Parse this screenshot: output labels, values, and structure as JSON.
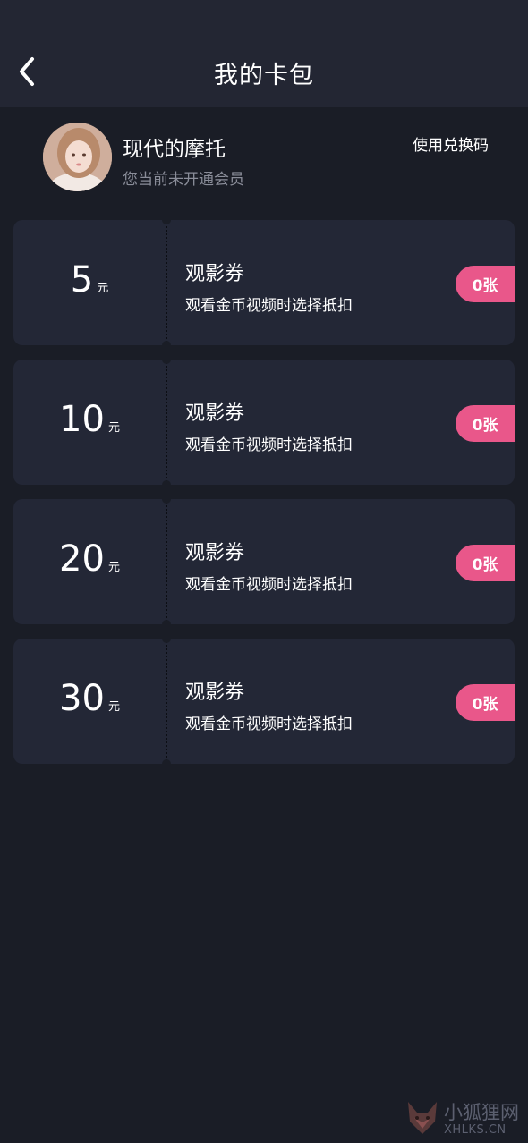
{
  "header": {
    "title": "我的卡包"
  },
  "profile": {
    "username": "现代的摩托",
    "member_status": "您当前未开通会员",
    "redeem_label": "使用兑换码"
  },
  "coupons": [
    {
      "amount": "5",
      "unit": "元",
      "title": "观影券",
      "desc": "观看金币视频时选择抵扣",
      "count": "0张"
    },
    {
      "amount": "10",
      "unit": "元",
      "title": "观影券",
      "desc": "观看金币视频时选择抵扣",
      "count": "0张"
    },
    {
      "amount": "20",
      "unit": "元",
      "title": "观影券",
      "desc": "观看金币视频时选择抵扣",
      "count": "0张"
    },
    {
      "amount": "30",
      "unit": "元",
      "title": "观影券",
      "desc": "观看金币视频时选择抵扣",
      "count": "0张"
    }
  ],
  "watermark": {
    "text": "小狐狸网",
    "sub": "XHLKS.CN"
  },
  "colors": {
    "badge": "#e9578a",
    "background": "#1a1d26",
    "card": "#232736"
  }
}
